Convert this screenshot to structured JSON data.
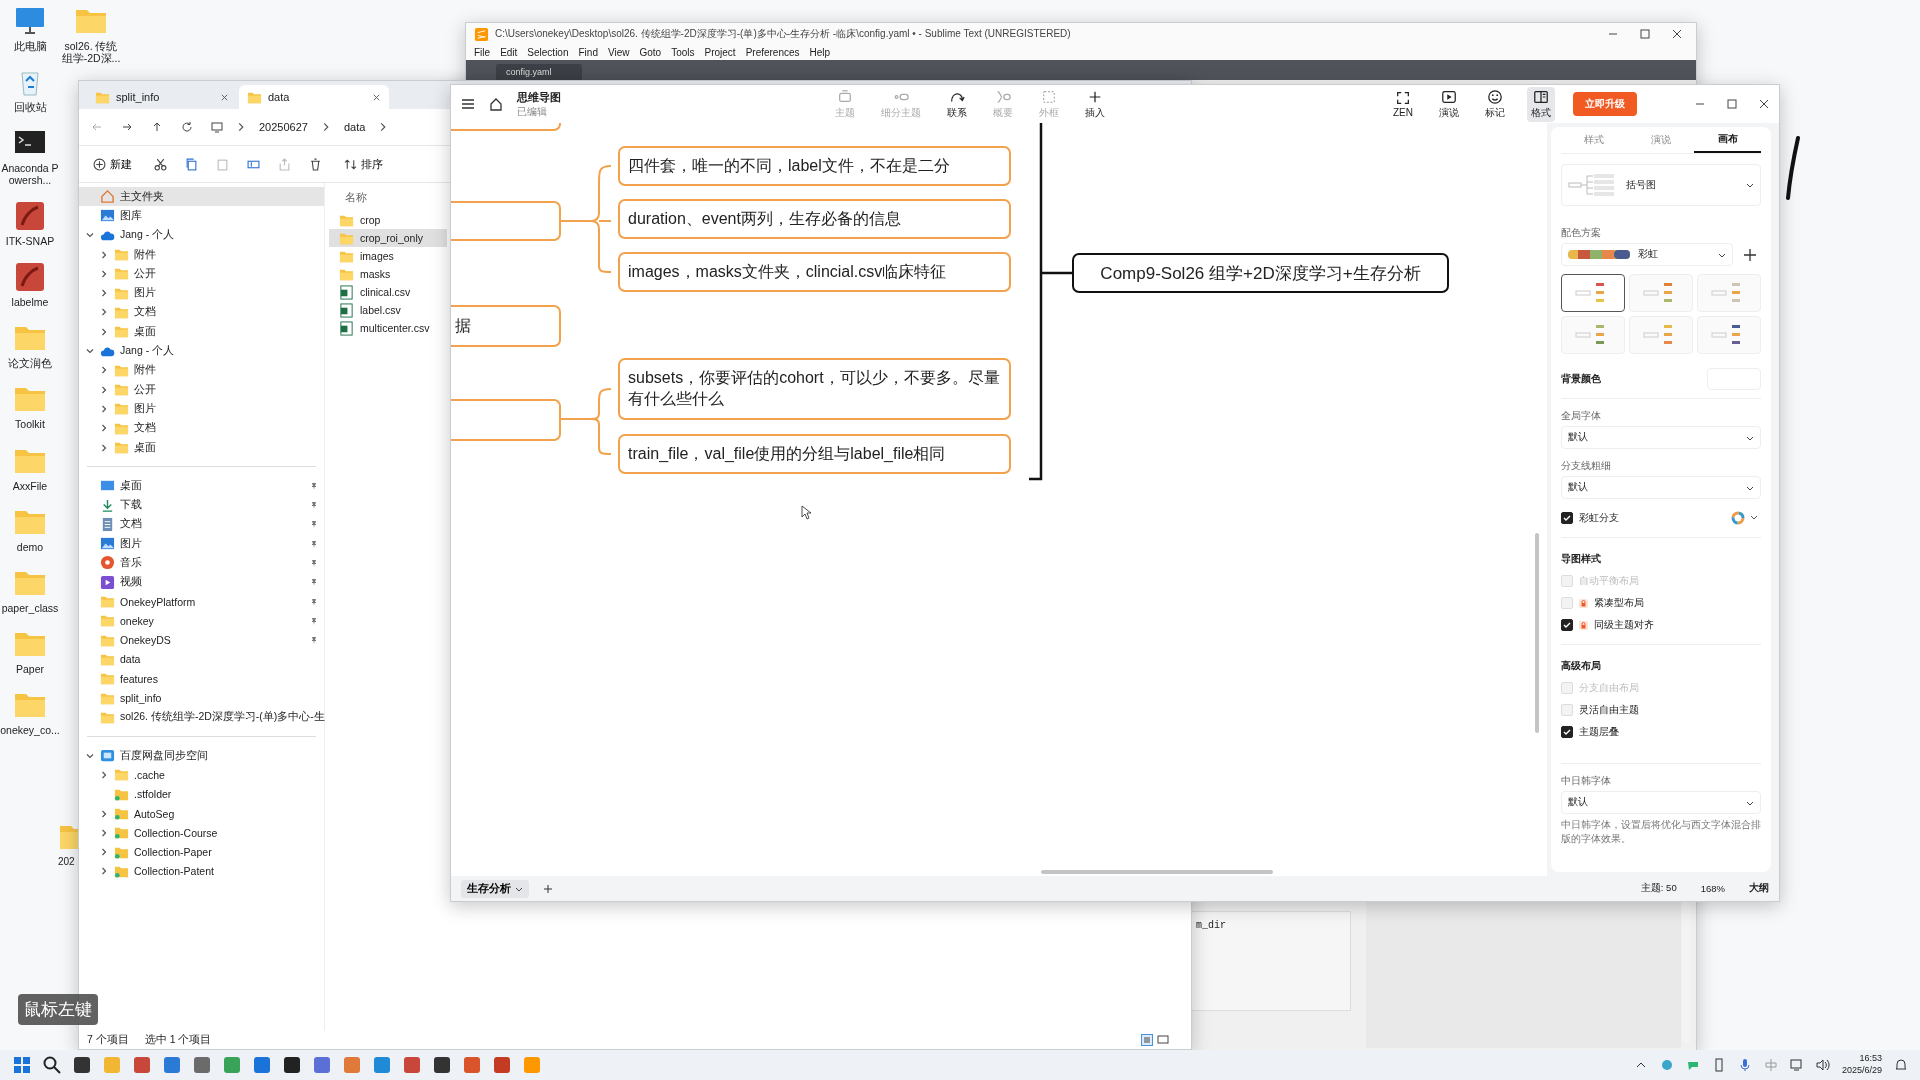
{
  "desktop_icons": [
    {
      "label": "此电脑",
      "kind": "pc"
    },
    {
      "label": "回收站",
      "kind": "recycle"
    },
    {
      "label": "Anaconda Powersh...",
      "kind": "terminal"
    },
    {
      "label": "ITK-SNAP",
      "kind": "app"
    },
    {
      "label": "labelme",
      "kind": "app"
    },
    {
      "label": "论文润色",
      "kind": "folder"
    },
    {
      "label": "Toolkit",
      "kind": "folder"
    },
    {
      "label": "AxxFile",
      "kind": "folder"
    },
    {
      "label": "demo",
      "kind": "folder"
    },
    {
      "label": "paper_class",
      "kind": "folder"
    },
    {
      "label": "Paper",
      "kind": "folder"
    },
    {
      "label": "onekey_co...",
      "kind": "folder"
    }
  ],
  "desktop_icons_second_column": [
    {
      "label": "sol26. 传统组学-2D深...",
      "kind": "folder"
    },
    {
      "label": "202",
      "kind": "folder"
    }
  ],
  "sublime": {
    "title": "C:\\Users\\onekey\\Desktop\\sol26. 传统组学-2D深度学习-(单)多中心-生存分析 -临床\\config.yaml • - Sublime Text (UNREGISTERED)",
    "menu": [
      "File",
      "Edit",
      "Selection",
      "Find",
      "View",
      "Goto",
      "Tools",
      "Project",
      "Preferences",
      "Help"
    ],
    "tab": "config.yaml",
    "code_fragment": "m_dir"
  },
  "explorer": {
    "tabs": [
      {
        "label": "split_info",
        "selected": false
      },
      {
        "label": "data",
        "selected": true
      }
    ],
    "breadcrumb": [
      "20250627",
      "data"
    ],
    "toolbar": {
      "new": "新建",
      "sort": "排序"
    },
    "nav_sections": [
      [
        {
          "label": "主文件夹",
          "kind": "home",
          "selected": true
        },
        {
          "label": "图库",
          "kind": "gallery",
          "selected": false
        },
        {
          "label": "Jang - 个人",
          "kind": "cloud",
          "selected": false,
          "expanded": true,
          "children": [
            {
              "label": "附件",
              "kind": "folder",
              "selected": false,
              "expanded": false
            },
            {
              "label": "公开",
              "kind": "folder",
              "selected": false,
              "expanded": false
            },
            {
              "label": "图片",
              "kind": "folder",
              "selected": false,
              "expanded": false
            },
            {
              "label": "文档",
              "kind": "folder",
              "selected": false,
              "expanded": false
            },
            {
              "label": "桌面",
              "kind": "folder",
              "selected": false,
              "expanded": false
            }
          ]
        },
        {
          "label": "Jang - 个人",
          "kind": "cloud",
          "selected": false,
          "expanded": true,
          "children": [
            {
              "label": "附件",
              "kind": "folder",
              "selected": false,
              "expanded": false
            },
            {
              "label": "公开",
              "kind": "folder",
              "selected": false,
              "expanded": false
            },
            {
              "label": "图片",
              "kind": "folder",
              "selected": false,
              "expanded": false
            },
            {
              "label": "文档",
              "kind": "folder",
              "selected": false,
              "expanded": false
            },
            {
              "label": "桌面",
              "kind": "folder",
              "selected": false,
              "expanded": false
            }
          ]
        }
      ],
      [
        {
          "label": "桌面",
          "kind": "desktop",
          "selected": false,
          "pinned": true
        },
        {
          "label": "下载",
          "kind": "download",
          "selected": false,
          "pinned": true
        },
        {
          "label": "文档",
          "kind": "document",
          "selected": false,
          "pinned": true
        },
        {
          "label": "图片",
          "kind": "gallery",
          "selected": false,
          "pinned": true
        },
        {
          "label": "音乐",
          "kind": "music",
          "selected": false,
          "pinned": true
        },
        {
          "label": "视频",
          "kind": "video",
          "selected": false,
          "pinned": true
        },
        {
          "label": "OnekeyPlatform",
          "kind": "folder",
          "selected": false,
          "pinned": true
        },
        {
          "label": "onekey",
          "kind": "folder",
          "selected": false,
          "pinned": true
        },
        {
          "label": "OnekeyDS",
          "kind": "folder",
          "selected": false,
          "pinned": true
        },
        {
          "label": "data",
          "kind": "folder",
          "selected": false,
          "pinned": false
        },
        {
          "label": "features",
          "kind": "folder",
          "selected": false,
          "pinned": false
        },
        {
          "label": "split_info",
          "kind": "folder",
          "selected": false,
          "pinned": false
        },
        {
          "label": "sol26. 传统组学-2D深度学习-(单)多中心-生",
          "kind": "folder",
          "selected": false
        }
      ],
      [
        {
          "label": "百度网盘同步空间",
          "kind": "drive",
          "selected": false,
          "expanded": true,
          "children": [
            {
              "label": ".cache",
              "kind": "folder",
              "selected": false,
              "expanded": false
            },
            {
              "label": ".stfolder",
              "kind": "syncfolder",
              "selected": false
            },
            {
              "label": "AutoSeg",
              "kind": "syncfolder",
              "selected": false,
              "expanded": false
            },
            {
              "label": "Collection-Course",
              "kind": "syncfolder",
              "selected": false,
              "expanded": false
            },
            {
              "label": "Collection-Paper",
              "kind": "syncfolder",
              "selected": false,
              "expanded": false
            },
            {
              "label": "Collection-Patent",
              "kind": "syncfolder",
              "selected": false,
              "expanded": false
            }
          ]
        }
      ]
    ],
    "column_header": "名称",
    "files": [
      {
        "name": "crop",
        "kind": "folder",
        "selected": false
      },
      {
        "name": "crop_roi_only",
        "kind": "folder",
        "selected": true
      },
      {
        "name": "images",
        "kind": "folder",
        "selected": false
      },
      {
        "name": "masks",
        "kind": "folder",
        "selected": false
      },
      {
        "name": "clinical.csv",
        "kind": "csv",
        "selected": false
      },
      {
        "name": "label.csv",
        "kind": "csv",
        "selected": false
      },
      {
        "name": "multicenter.csv",
        "kind": "csv",
        "selected": false
      }
    ],
    "status": {
      "count": "7 个项目",
      "selection": "选中 1 个项目"
    }
  },
  "mindmap": {
    "app_title": "思维导图",
    "subtitle": "已编辑",
    "tools": [
      {
        "label": "主题",
        "kind": "topic",
        "disabled": true
      },
      {
        "label": "细分主题",
        "kind": "subtopic",
        "disabled": true
      },
      {
        "label": "联系",
        "kind": "relation",
        "disabled": false
      },
      {
        "label": "概要",
        "kind": "summary",
        "disabled": true
      },
      {
        "label": "外框",
        "kind": "boundary",
        "disabled": true
      },
      {
        "label": "插入",
        "kind": "insert",
        "disabled": false
      }
    ],
    "view_tools": [
      {
        "label": "ZEN",
        "kind": "zen",
        "selected": false
      },
      {
        "label": "演说",
        "kind": "play",
        "selected": false
      },
      {
        "label": "标记",
        "kind": "smile",
        "selected": false
      },
      {
        "label": "格式",
        "kind": "panel",
        "selected": true
      }
    ],
    "upgrade": "立即升级",
    "root": "Comp9-Sol26 组学+2D深度学习+生存分析",
    "partial_node": "据",
    "groups": [
      {
        "nodes": [
          "四件套，唯一的不同，label文件，不在是二分",
          "duration、event两列，生存必备的信息",
          "images，masks文件夹，clincial.csv临床特征"
        ]
      },
      {
        "nodes": [
          "subsets，你要评估的cohort，可以少，不要多。尽量有什么些什么",
          "train_file，val_file使用的分组与label_file相同"
        ]
      }
    ],
    "panel": {
      "tabs": [
        {
          "label": "样式",
          "selected": false
        },
        {
          "label": "演说",
          "selected": false
        },
        {
          "label": "画布",
          "selected": true
        }
      ],
      "structure": "括号图",
      "color_scheme_label": "配色方案",
      "color_scheme": "彩虹",
      "themes": [
        {
          "selected": true
        },
        {
          "selected": false
        },
        {
          "selected": false
        },
        {
          "selected": false
        },
        {
          "selected": false
        },
        {
          "selected": false
        }
      ],
      "background_label": "背景颜色",
      "font_label": "全局字体",
      "font_value": "默认",
      "branch_label": "分支线粗细",
      "branch_value": "默认",
      "rainbow": {
        "label": "彩虹分支",
        "checked": true
      },
      "sections": [
        {
          "title": "导图样式",
          "options": [
            {
              "label": "自动平衡布局",
              "checked": false,
              "disabled": true,
              "locked": false
            },
            {
              "label": "紧凑型布局",
              "checked": false,
              "disabled": false,
              "locked": true
            },
            {
              "label": "同级主题对齐",
              "checked": true,
              "disabled": false,
              "locked": true
            }
          ]
        },
        {
          "title": "高级布局",
          "options": [
            {
              "label": "分支自由布局",
              "checked": false,
              "disabled": true,
              "locked": false
            },
            {
              "label": "灵活自由主题",
              "checked": false,
              "disabled": false,
              "locked": false
            },
            {
              "label": "主题层叠",
              "checked": true,
              "disabled": false,
              "locked": false
            }
          ]
        }
      ],
      "cjk_label": "中日韩字体",
      "cjk_value": "默认",
      "cjk_note": "中日韩字体，设置后将优化与西文字体混合排版的字体效果。"
    },
    "sheet_tab": "生存分析",
    "topic_count": "主题: 50",
    "zoom": "168%",
    "outline": "大纲"
  },
  "overlay_hint": "鼠标左键",
  "taskbar": {
    "time": "16:53",
    "date": "2025/6/29"
  }
}
